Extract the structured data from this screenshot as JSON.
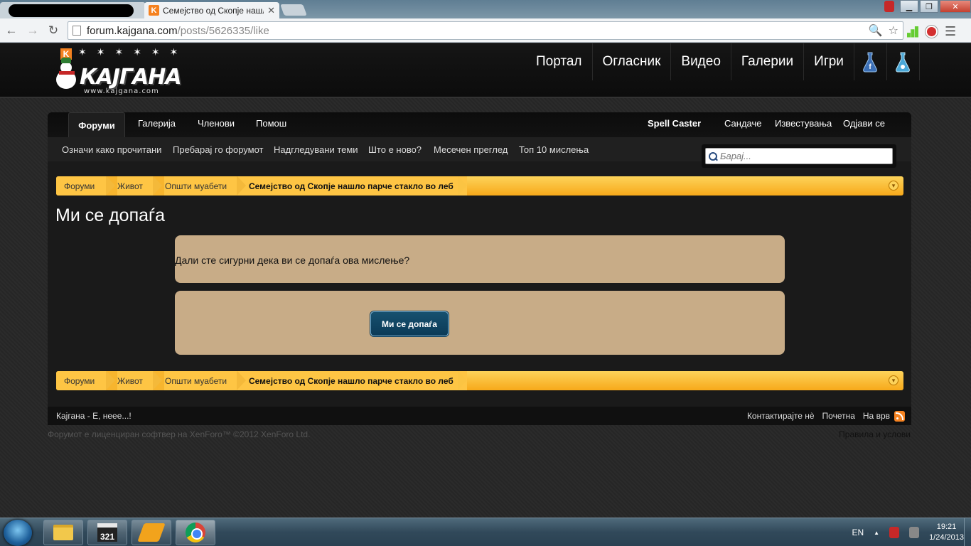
{
  "browser": {
    "active_tab_title": "Семејство од Скопје нашло парче стакло во леб",
    "tab_close": "✕",
    "url_host": "forum.kajgana.com",
    "url_path": "/posts/5626335/like",
    "back": "←",
    "forward": "→",
    "reload": "↻",
    "zoom_icon": "🔍",
    "star_icon": "☆",
    "wrench_icon": "☰",
    "win_minimize": "▁",
    "win_maximize": "❐",
    "win_close": "✕"
  },
  "site": {
    "logo_k": "K",
    "logo_text": "КАЈГАНА",
    "logo_sub": "www.kajgana.com",
    "logo_stars": "✶✶✶✶✶✶",
    "portal_nav": [
      "Портал",
      "Огласник",
      "Видео",
      "Галерии",
      "Игри"
    ]
  },
  "forum": {
    "tabs": {
      "forums": "Форуми",
      "gallery": "Галерија",
      "members": "Членови",
      "help": "Помош"
    },
    "user": {
      "name": "Spell Caster",
      "inbox": "Сандаче",
      "alerts": "Известувања",
      "logout": "Одјави се"
    },
    "subnav": [
      "Означи како прочитани",
      "Пребарај го форумот",
      "Надгледувани теми",
      "Што е ново?",
      "Месечен преглед",
      "Топ 10 мислења"
    ],
    "search_placeholder": "Барај..."
  },
  "breadcrumb": {
    "items": [
      "Форуми",
      "Живот",
      "Општи муабети"
    ],
    "current": "Семејство од Скопје нашло парче стакло во леб",
    "toggle": "▾"
  },
  "content": {
    "title": "Ми се допаѓа",
    "question": "Дали сте сигурни дека ви се допаѓа ова мислење?",
    "like_button": "Ми се допаѓа"
  },
  "footer": {
    "left": "Кајгана - Е, нееe...!",
    "links": [
      "Контактирајте нè",
      "Почетна",
      "На врв"
    ],
    "copyright": "Форумот е лиценциран софтвер на XenForo™ ©2012 XenForo Ltd.",
    "terms": "Правила и услови"
  },
  "taskbar": {
    "media_label": "321",
    "language": "EN",
    "tray_arrow": "▲",
    "time": "19:21",
    "date": "1/24/2013"
  },
  "colors": {
    "breadcrumb": "#f7a91a",
    "panel": "#c8ac87",
    "like_button": "#0b3a57",
    "header": "#0c0c0c"
  }
}
